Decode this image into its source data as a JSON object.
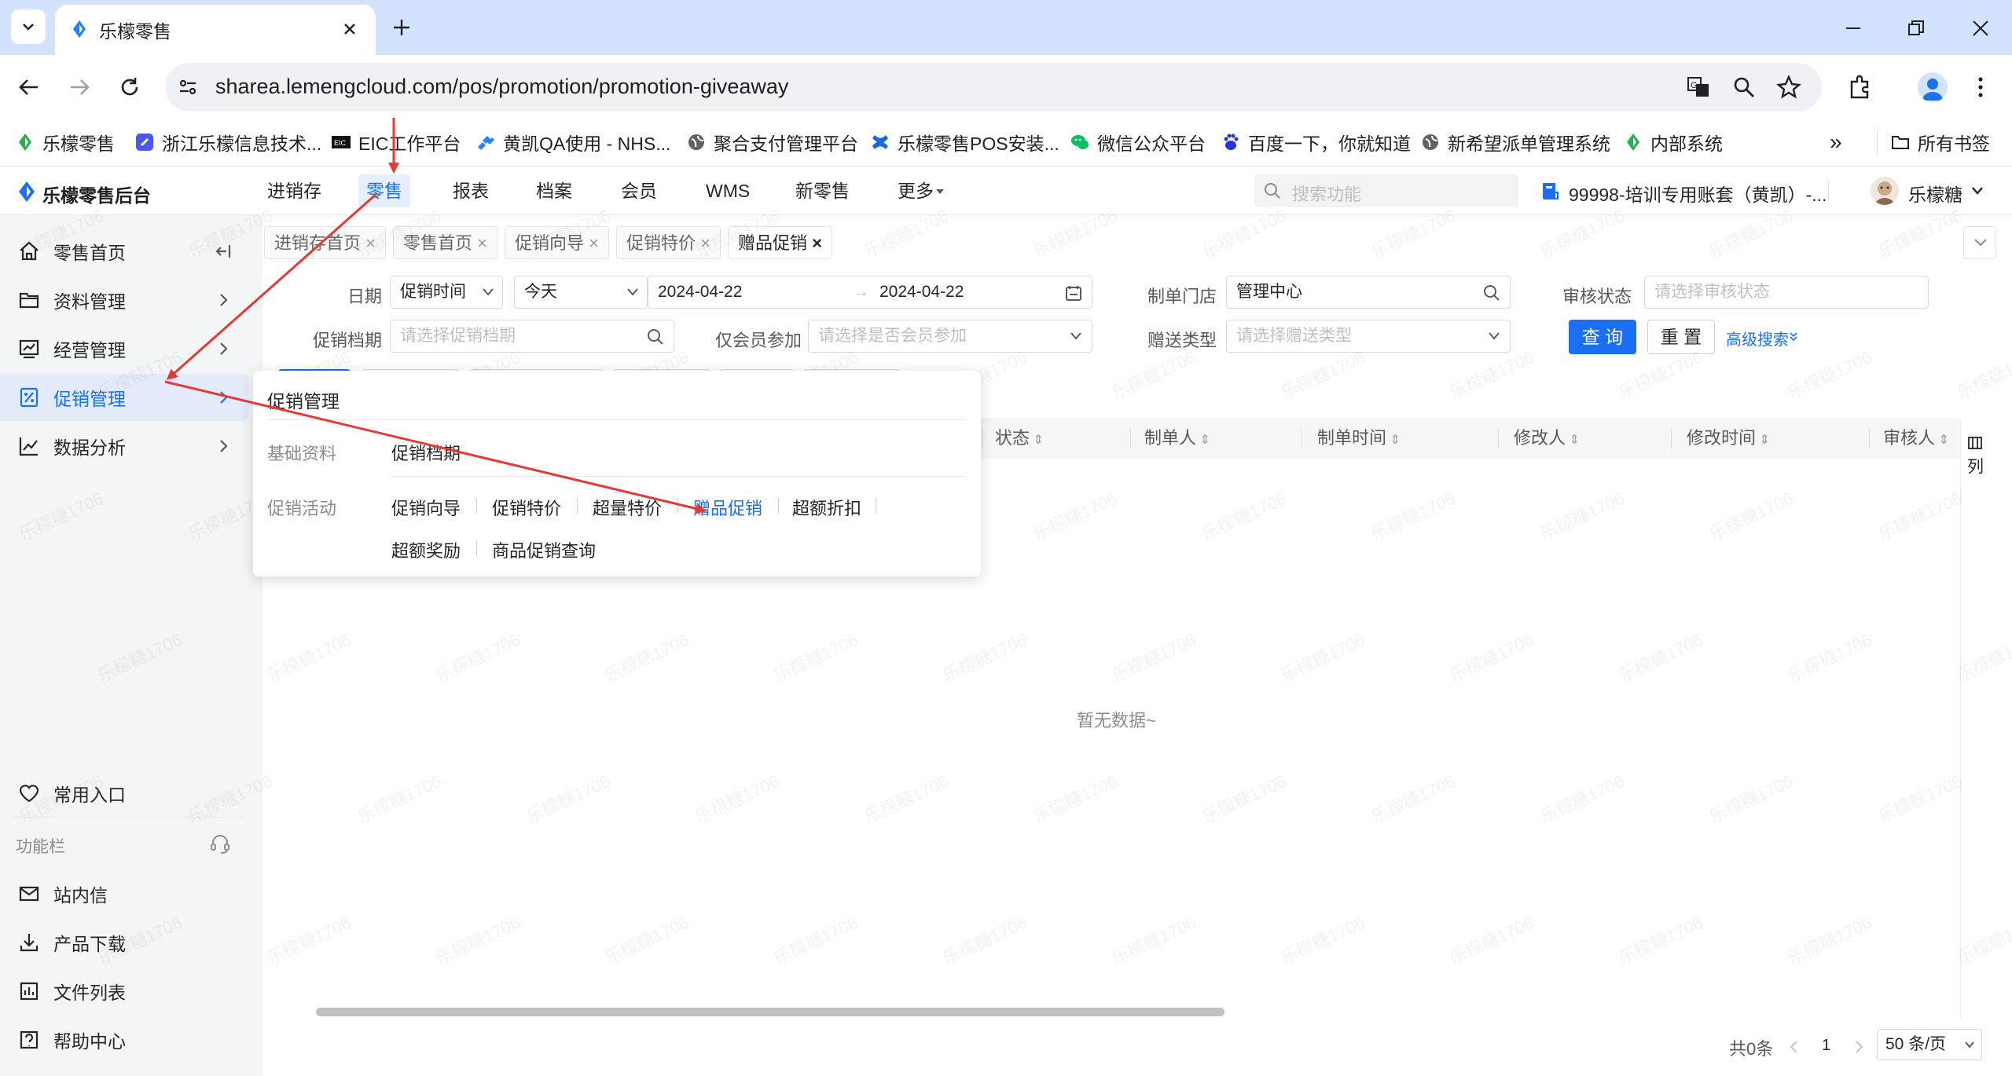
{
  "browser": {
    "tab_title": "乐檬零售",
    "url": "sharea.lemengcloud.com/pos/promotion/promotion-giveaway",
    "bookmarks": [
      "乐檬零售",
      "浙江乐檬信息技术...",
      "EIC工作平台",
      "黄凯QA使用 - NHS...",
      "聚合支付管理平台",
      "乐檬零售POS安装...",
      "微信公众平台",
      "百度一下，你就知道",
      "新希望派单管理系统",
      "内部系统"
    ],
    "all_bookmarks": "所有书签",
    "more_bookmarks": "»"
  },
  "app": {
    "logo": "乐檬零售后台",
    "nav": [
      "进销存",
      "零售",
      "报表",
      "档案",
      "会员",
      "WMS",
      "新零售",
      "更多"
    ],
    "active_nav": "零售",
    "search_placeholder": "搜索功能",
    "account": "99998-培训专用账套（黄凯）-...",
    "user": "乐檬糖"
  },
  "sidebar": {
    "items": [
      "零售首页",
      "资料管理",
      "经营管理",
      "促销管理",
      "数据分析"
    ],
    "active": "促销管理",
    "bottom": {
      "favorites": "常用入口",
      "section": "功能栏",
      "tools": [
        "站内信",
        "产品下载",
        "文件列表",
        "帮助中心"
      ]
    }
  },
  "page_tabs": [
    "进销存首页",
    "零售首页",
    "促销向导",
    "促销特价",
    "赠品促销"
  ],
  "filters": {
    "date_label": "日期",
    "date_type": "促销时间",
    "date_range_preset": "今天",
    "date_start": "2024-04-22",
    "date_arrow": "→",
    "date_end": "2024-04-22",
    "store_label": "制单门店",
    "store_value": "管理中心",
    "audit_label": "审核状态",
    "audit_placeholder": "请选择审核状态",
    "schedule_label": "促销档期",
    "schedule_placeholder": "请选择促销档期",
    "member_label": "仅会员参加",
    "member_placeholder": "请选择是否会员参加",
    "gift_label": "赠送类型",
    "gift_placeholder": "请选择赠送类型",
    "query_btn": "查 询",
    "reset_btn": "重 置",
    "advanced": "高级搜索"
  },
  "table": {
    "columns": [
      "状态",
      "制单人",
      "制单时间",
      "修改人",
      "修改时间",
      "审核人"
    ],
    "column_setting": "列",
    "empty": "暂无数据~"
  },
  "pagination": {
    "total": "共0条",
    "page": "1",
    "page_size": "50 条/页"
  },
  "flyout": {
    "title": "促销管理",
    "groups": [
      {
        "label": "基础资料",
        "links": [
          "促销档期"
        ]
      },
      {
        "label": "促销活动",
        "links": [
          "促销向导",
          "促销特价",
          "超量特价",
          "赠品促销",
          "超额折扣",
          "超额奖励",
          "商品促销查询"
        ]
      }
    ],
    "active_link": "赠品促销"
  },
  "watermark": "乐檬糖1706",
  "colors": {
    "primary": "#1b6ff5",
    "annotation": "#e53935",
    "sidebar_bg": "#f4f5f7",
    "tab_strip": "#d3e3fd"
  }
}
